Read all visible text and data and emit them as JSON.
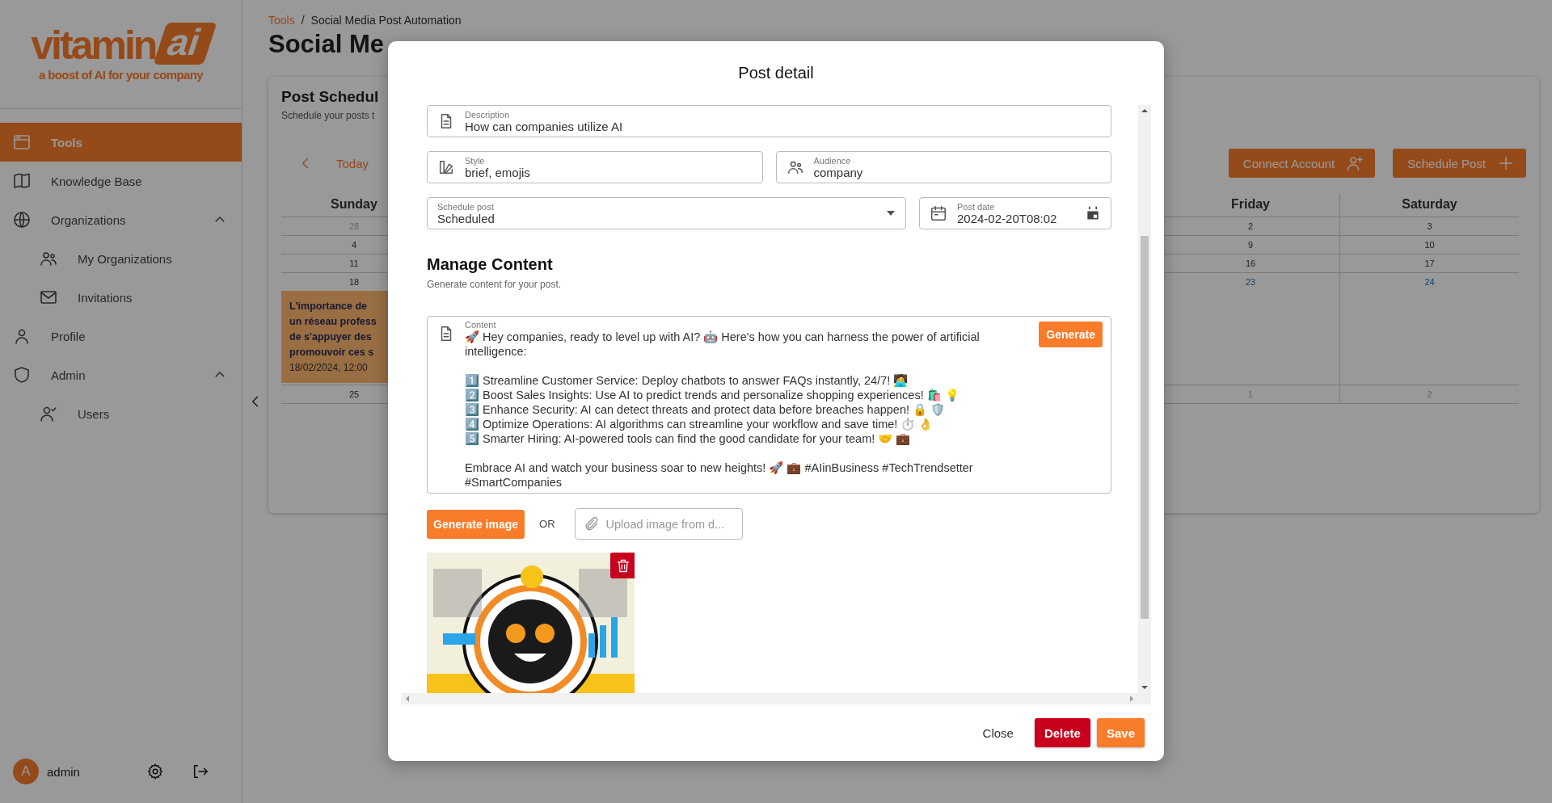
{
  "sidebar": {
    "logo": {
      "word": "vitamin",
      "badge": "ai",
      "tagline": "a boost of AI for your company"
    },
    "items": [
      {
        "label": "Tools",
        "selected": true
      },
      {
        "label": "Knowledge Base",
        "selected": false
      },
      {
        "label": "Organizations",
        "selected": false,
        "expanded": true,
        "children": [
          {
            "label": "My Organizations",
            "selected": false
          },
          {
            "label": "Invitations",
            "selected": false
          }
        ]
      },
      {
        "label": "Profile",
        "selected": false
      },
      {
        "label": "Admin",
        "selected": false,
        "expanded": true,
        "children": [
          {
            "label": "Users",
            "selected": false
          }
        ]
      }
    ],
    "user": {
      "initial": "A",
      "name": "admin"
    }
  },
  "breadcrumb": {
    "items": [
      "Tools",
      "Social Media Post Automation"
    ],
    "separator": "/"
  },
  "title": "Social Me",
  "scheduler": {
    "title": "Post Schedul",
    "subtitle": "Schedule your posts t",
    "today": "Today",
    "actions": [
      "Connect Account",
      "Schedule Post"
    ],
    "calendar": {
      "days": [
        "Sunday",
        "Friday",
        "Saturday"
      ],
      "weeks": [
        {
          "dates": [
            {
              "text": "28",
              "muted": true,
              "highlighted": false
            },
            {
              "text": "2",
              "muted": false,
              "highlighted": false
            },
            {
              "text": "3",
              "muted": false,
              "highlighted": false
            }
          ]
        },
        {
          "dates": [
            {
              "text": "4",
              "muted": false,
              "highlighted": false
            },
            {
              "text": "9",
              "muted": false,
              "highlighted": false
            },
            {
              "text": "10",
              "muted": false,
              "highlighted": false
            }
          ]
        },
        {
          "dates": [
            {
              "text": "11",
              "muted": false,
              "highlighted": false
            },
            {
              "text": "16",
              "muted": false,
              "highlighted": false
            },
            {
              "text": "17",
              "muted": false,
              "highlighted": false
            }
          ]
        },
        {
          "dates": [
            {
              "text": "18",
              "muted": false,
              "highlighted": false
            },
            {
              "text": "23",
              "muted": false,
              "highlighted": true
            },
            {
              "text": "24",
              "muted": false,
              "highlighted": true
            }
          ],
          "event": {
            "lines": [
              "L'importance de",
              "un réseau profess",
              "de s'appuyer des",
              "promouvoir ces s"
            ],
            "time": "18/02/2024, 12:00"
          }
        },
        {
          "dates": [
            {
              "text": "25",
              "muted": false,
              "highlighted": false
            },
            {
              "text": "1",
              "muted": true,
              "highlighted": false
            },
            {
              "text": "2",
              "muted": true,
              "highlighted": false
            }
          ]
        }
      ]
    }
  },
  "modal": {
    "title": "Post detail",
    "description": {
      "label": "Description",
      "value": "How can companies utilize AI"
    },
    "style": {
      "label": "Style",
      "value": "brief, emojis"
    },
    "audience": {
      "label": "Audience",
      "value": "company"
    },
    "schedule": {
      "label": "Schedule post",
      "value": "Scheduled"
    },
    "post_date": {
      "label": "Post date",
      "value": "2024-02-20T08:02"
    },
    "manage": {
      "title": "Manage Content",
      "subtitle": "Generate content for your post."
    },
    "content": {
      "label": "Content",
      "generate": "Generate",
      "intro": "🚀 Hey companies, ready to level up with AI? 🤖 Here's how you can harness the power of artificial intelligence:",
      "items": [
        "1️⃣ Streamline Customer Service: Deploy chatbots to answer FAQs instantly, 24/7! 🧑‍💻",
        "2️⃣ Boost Sales Insights: Use AI to predict trends and personalize shopping experiences! 🛍️ 💡",
        "3️⃣ Enhance Security: AI can detect threats and protect data before breaches happen! 🔒 🛡️",
        "4️⃣ Optimize Operations: AI algorithms can streamline your workflow and save time! ⏱️ 👌",
        "5️⃣ Smarter Hiring: AI-powered tools can find the good candidate for your team! 🤝 💼"
      ],
      "outro": "Embrace AI and watch your business soar to new heights! 🚀 💼 #AIinBusiness #TechTrendsetter #SmartCompanies"
    },
    "image_actions": {
      "generate": "Generate image",
      "or": "OR",
      "upload_placeholder": "Upload image from d..."
    },
    "footer": [
      {
        "label": "Close",
        "kind": "text"
      },
      {
        "label": "Delete",
        "kind": "danger"
      },
      {
        "label": "Save",
        "kind": "primary"
      }
    ]
  }
}
